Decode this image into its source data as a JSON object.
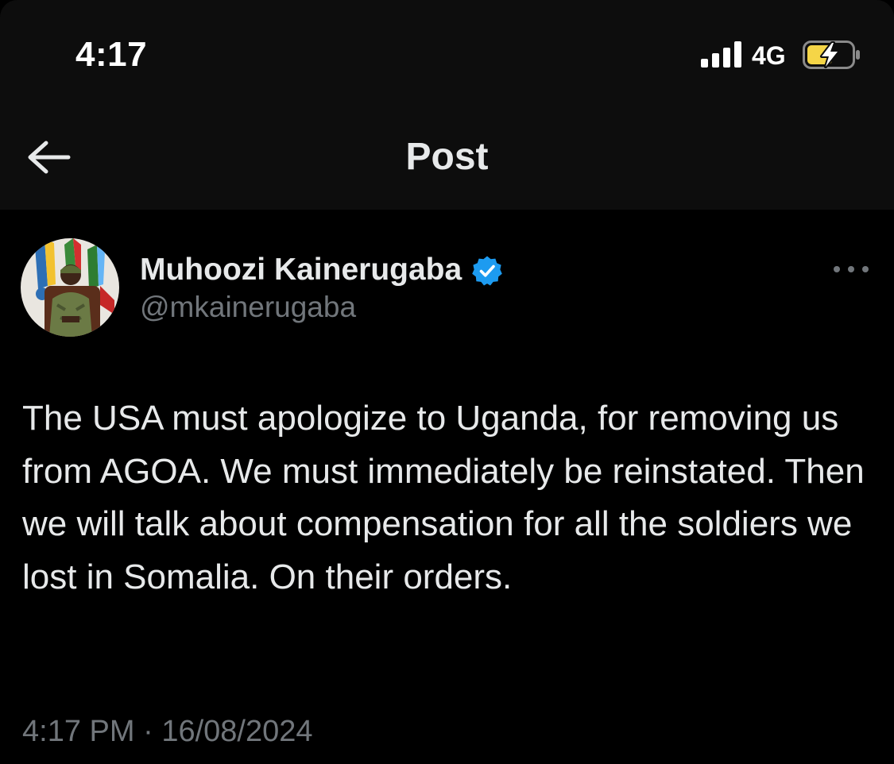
{
  "status_bar": {
    "time": "4:17",
    "network": "4G",
    "icons": [
      "signal-icon",
      "battery-charging-icon"
    ]
  },
  "nav": {
    "back_icon": "arrow-left-icon",
    "title": "Post"
  },
  "post": {
    "author": {
      "display_name": "Muhoozi Kainerugaba",
      "handle": "@mkainerugaba",
      "verified": true,
      "verified_color": "#1d9bf0"
    },
    "more_icon": "more-dots-icon",
    "text": "The USA must apologize to Uganda, for removing us from AGOA. We must immediately be reinstated. Then we will talk about compensation for all the soldiers we lost in Somalia. On their orders.",
    "time": "4:17 PM",
    "separator": " · ",
    "date": "16/08/2024"
  },
  "colors": {
    "background": "#000000",
    "header_background": "#0d0d0d",
    "text_primary": "#e7e9ea",
    "text_secondary": "#71767b",
    "battery_fill": "#f5d547"
  }
}
